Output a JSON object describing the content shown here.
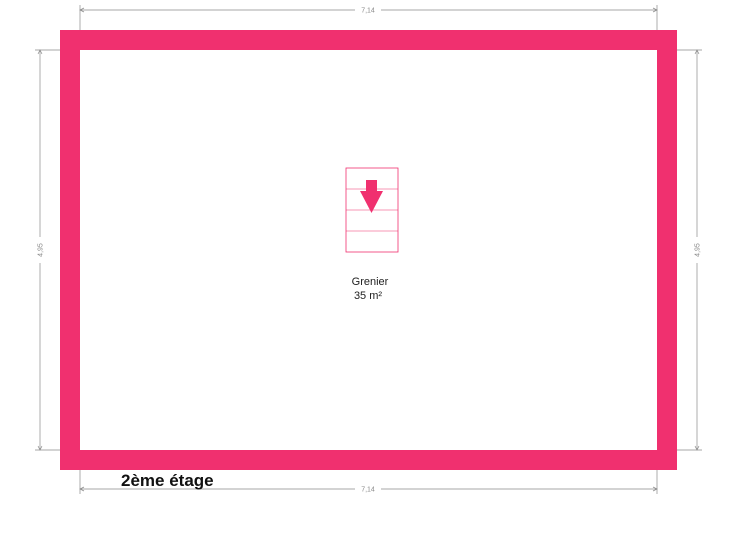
{
  "colors": {
    "wall": "#f0306f",
    "dimension": "#8a8a8a",
    "stair_line": "#f0306f"
  },
  "dimensions": {
    "top": "7,14",
    "bottom": "7,14",
    "left": "4,95",
    "right": "4,95"
  },
  "room": {
    "name": "Grenier",
    "area": "35 m²"
  },
  "stairs": {
    "icon": "stair-down-arrow-icon"
  },
  "floor_label": "2ème étage"
}
